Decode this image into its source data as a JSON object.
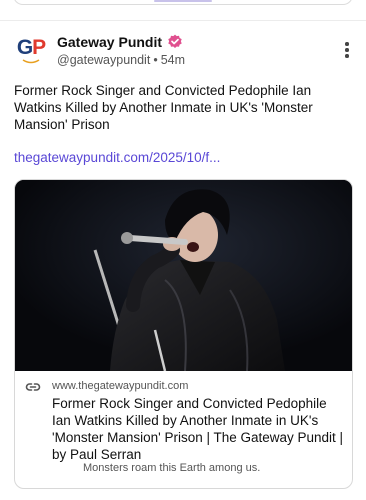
{
  "account": {
    "avatar_text_g": "G",
    "avatar_text_p": "P",
    "display_name": "Gateway Pundit",
    "handle": "@gatewaypundit",
    "separator": "•",
    "age": "54m",
    "verified_color": "#e0508f"
  },
  "post": {
    "text": "Former Rock Singer and Convicted Pedophile Ian Watkins Killed by Another Inmate in UK's 'Monster Mansion' Prison",
    "link_text": "thegatewaypundit.com/2025/10/f...",
    "link_color": "#5a48d6"
  },
  "link_card": {
    "domain": "www.thegatewaypundit.com",
    "title": "Former Rock Singer and Convicted Pedophile Ian Watkins Killed by Another Inmate in UK's 'Monster Mansion' Prison | The Gateway Pundit | by Paul Serran",
    "description": "Monsters roam this Earth among us."
  },
  "icons": {
    "avatar": "gateway-pundit-logo",
    "verified": "verified-badge-icon",
    "more": "more-options-icon",
    "link": "link-icon"
  }
}
